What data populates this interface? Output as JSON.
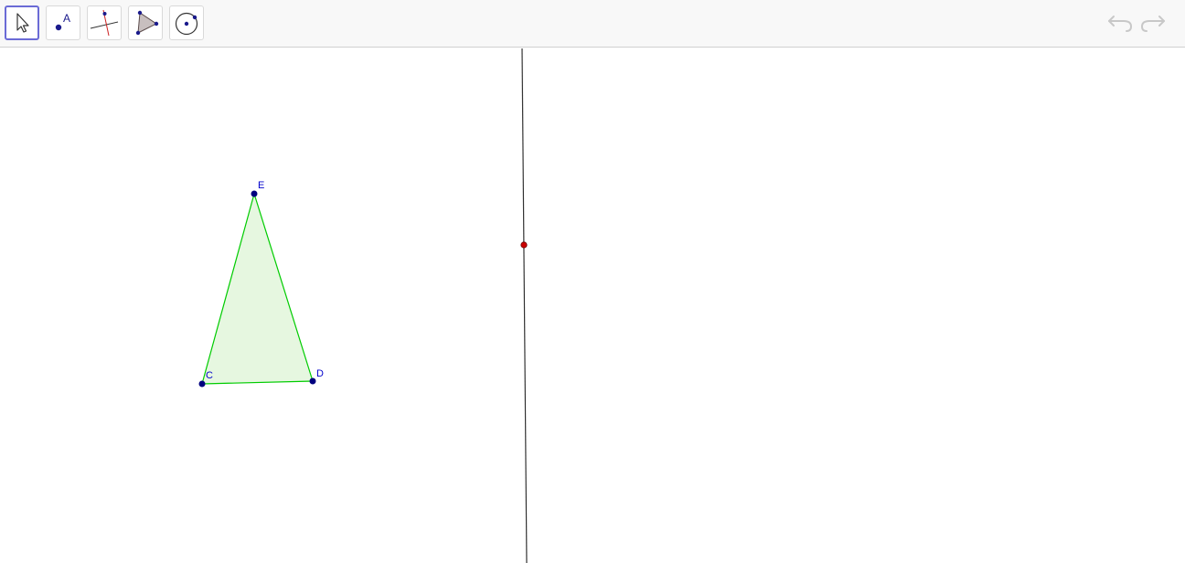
{
  "toolbar": {
    "tools": [
      {
        "name": "move-tool",
        "icon": "cursor-arrow-icon",
        "selected": true
      },
      {
        "name": "point-tool",
        "icon": "point-A-icon",
        "label": "A",
        "selected": false
      },
      {
        "name": "perpendicular-line-tool",
        "icon": "perpendicular-lines-icon",
        "selected": false
      },
      {
        "name": "polygon-tool",
        "icon": "polygon-icon",
        "selected": false
      },
      {
        "name": "circle-tool",
        "icon": "circle-with-center-icon",
        "selected": false
      }
    ],
    "undo": {
      "icon": "undo-icon",
      "enabled": false
    },
    "redo": {
      "icon": "redo-icon",
      "enabled": false
    }
  },
  "graphics": {
    "points": [
      {
        "label": "E",
        "color": "#00007f"
      },
      {
        "label": "C",
        "color": "#00007f"
      },
      {
        "label": "D",
        "color": "#00007f"
      }
    ],
    "polygon": {
      "vertices": [
        "C",
        "D",
        "E"
      ],
      "stroke": "#00cc00",
      "fill": "#e6f7e0"
    },
    "line": {
      "color": "#333333"
    },
    "line_point": {
      "color": "#cc0000"
    }
  },
  "colors": {
    "selected_tool_border": "#6b6bd6",
    "point_label": "#0000cc"
  }
}
